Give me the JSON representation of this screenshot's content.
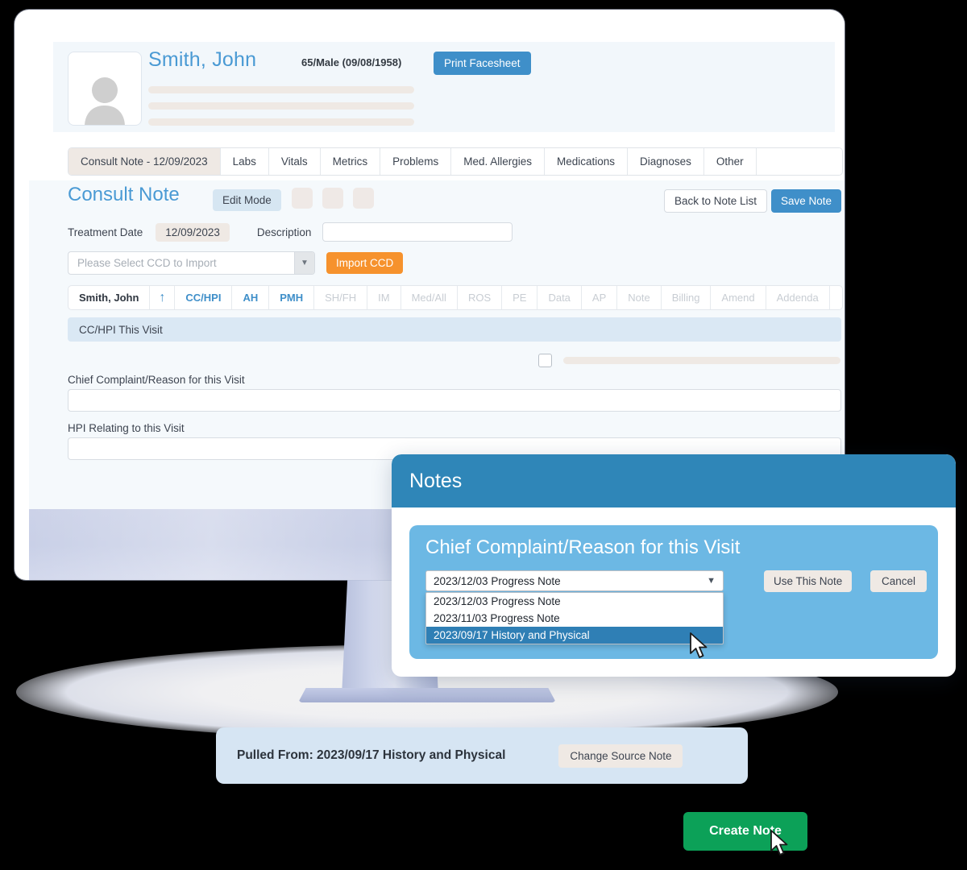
{
  "patient": {
    "name": "Smith, John",
    "demographics": "65/Male (09/08/1958)",
    "print_facesheet_label": "Print Facesheet"
  },
  "tabs": [
    {
      "label": "Consult Note - 12/09/2023",
      "active": true
    },
    {
      "label": "Labs",
      "active": false
    },
    {
      "label": "Vitals",
      "active": false
    },
    {
      "label": "Metrics",
      "active": false
    },
    {
      "label": "Problems",
      "active": false
    },
    {
      "label": "Med. Allergies",
      "active": false
    },
    {
      "label": "Medications",
      "active": false
    },
    {
      "label": "Diagnoses",
      "active": false
    },
    {
      "label": "Other",
      "active": false
    }
  ],
  "note": {
    "title": "Consult Note",
    "edit_mode_label": "Edit Mode",
    "back_label": "Back to Note List",
    "save_label": "Save Note",
    "treatment_date_label": "Treatment Date",
    "treatment_date_value": "12/09/2023",
    "description_label": "Description",
    "description_value": "",
    "description_placeholder": "",
    "ccd_placeholder": "Please Select CCD to Import",
    "import_ccd_label": "Import CCD",
    "section_banner": "CC/HPI This Visit",
    "chief_complaint_label": "Chief Complaint/Reason for this Visit",
    "chief_complaint_value": "",
    "hpi_label": "HPI Relating to this Visit",
    "hpi_value": ""
  },
  "sections": [
    {
      "label": "Smith, John",
      "state": "name"
    },
    {
      "label": "↑",
      "state": "arrow"
    },
    {
      "label": "CC/HPI",
      "state": "on"
    },
    {
      "label": "AH",
      "state": "on"
    },
    {
      "label": "PMH",
      "state": "on"
    },
    {
      "label": "SH/FH",
      "state": "off"
    },
    {
      "label": "IM",
      "state": "off"
    },
    {
      "label": "Med/All",
      "state": "off"
    },
    {
      "label": "ROS",
      "state": "off"
    },
    {
      "label": "PE",
      "state": "off"
    },
    {
      "label": "Data",
      "state": "off"
    },
    {
      "label": "AP",
      "state": "off"
    },
    {
      "label": "Note",
      "state": "off"
    },
    {
      "label": "Billing",
      "state": "off"
    },
    {
      "label": "Amend",
      "state": "off"
    },
    {
      "label": "Addenda",
      "state": "off"
    }
  ],
  "notes_modal": {
    "title": "Notes",
    "panel_title": "Chief Complaint/Reason for this Visit",
    "selected_option": "2023/12/03 Progress Note",
    "options": [
      {
        "label": "2023/12/03 Progress Note",
        "selected": false
      },
      {
        "label": "2023/11/03 Progress Note",
        "selected": false
      },
      {
        "label": "2023/09/17 History and Physical",
        "selected": true
      }
    ],
    "use_this_note_label": "Use This Note",
    "cancel_label": "Cancel"
  },
  "pulled_from": {
    "text": "Pulled From: 2023/09/17 History and Physical",
    "change_source_label": "Change Source Note"
  },
  "create_note_label": "Create Note",
  "colors": {
    "accent_blue": "#3f8fc9",
    "modal_header_blue": "#2f86b8",
    "panel_blue": "#6cb8e4",
    "orange": "#f6922d",
    "green": "#0ca158",
    "beige": "#efe9e4",
    "page_bg": "#f5f9fc",
    "pulled_bar_blue": "#d6e5f3",
    "dropdown_selected": "#2f7fb5"
  }
}
